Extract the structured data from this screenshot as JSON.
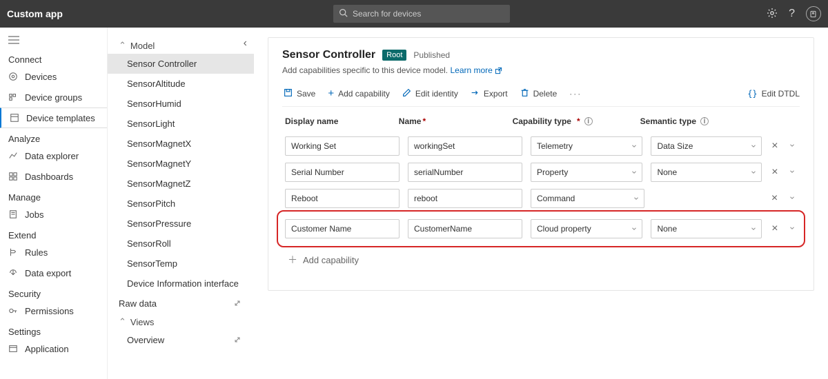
{
  "top": {
    "app_name": "Custom app",
    "search_placeholder": "Search for devices"
  },
  "nav": {
    "connect": "Connect",
    "devices": "Devices",
    "device_groups": "Device groups",
    "device_templates": "Device templates",
    "analyze": "Analyze",
    "data_explorer": "Data explorer",
    "dashboards": "Dashboards",
    "manage": "Manage",
    "jobs": "Jobs",
    "extend": "Extend",
    "rules": "Rules",
    "data_export": "Data export",
    "security": "Security",
    "permissions": "Permissions",
    "settings": "Settings",
    "application": "Application"
  },
  "tree": {
    "model": "Model",
    "items": [
      "Sensor Controller",
      "SensorAltitude",
      "SensorHumid",
      "SensorLight",
      "SensorMagnetX",
      "SensorMagnetY",
      "SensorMagnetZ",
      "SensorPitch",
      "SensorPressure",
      "SensorRoll",
      "SensorTemp",
      "Device Information interface"
    ],
    "raw_data": "Raw data",
    "views": "Views",
    "overview": "Overview"
  },
  "main": {
    "title": "Sensor Controller",
    "root_badge": "Root",
    "published": "Published",
    "subtitle": "Add capabilities specific to this device model.",
    "learn_more": "Learn more",
    "toolbar": {
      "save": "Save",
      "add_capability": "Add capability",
      "edit_identity": "Edit identity",
      "export": "Export",
      "delete": "Delete",
      "edit_dtdl": "Edit DTDL"
    },
    "columns": {
      "display_name": "Display name",
      "name": "Name",
      "capability_type": "Capability type",
      "semantic_type": "Semantic type"
    },
    "rows": [
      {
        "display_name": "Working Set",
        "name": "workingSet",
        "capability_type": "Telemetry",
        "semantic_type": "Data Size",
        "has_semantic": true,
        "highlight": false
      },
      {
        "display_name": "Serial Number",
        "name": "serialNumber",
        "capability_type": "Property",
        "semantic_type": "None",
        "has_semantic": true,
        "highlight": false
      },
      {
        "display_name": "Reboot",
        "name": "reboot",
        "capability_type": "Command",
        "semantic_type": "",
        "has_semantic": false,
        "highlight": false
      },
      {
        "display_name": "Customer Name",
        "name": "CustomerName",
        "capability_type": "Cloud property",
        "semantic_type": "None",
        "has_semantic": true,
        "highlight": true
      }
    ],
    "add_capability_row": "Add capability"
  }
}
